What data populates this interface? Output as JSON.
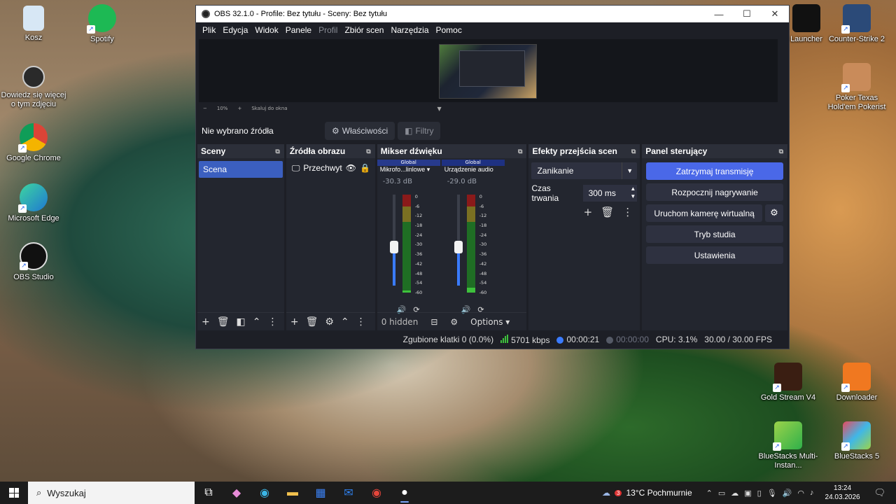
{
  "desktop": {
    "icons_left": [
      {
        "label": "Kosz"
      },
      {
        "label": "Dowiedz się więcej o tym zdjęciu"
      },
      {
        "label": "Google Chrome"
      },
      {
        "label": "Microsoft Edge"
      },
      {
        "label": "OBS Studio"
      }
    ],
    "icon_spotify": "Spotify",
    "icons_right": [
      {
        "label": "Launcher"
      },
      {
        "label": "Counter-Strike 2"
      },
      {
        "label": "Poker Texas Hold'em Pokerist"
      },
      {
        "label": "Gold Stream V4"
      },
      {
        "label": "Downloader"
      },
      {
        "label": "BlueStacks Multi-Instan..."
      },
      {
        "label": "BlueStacks 5"
      }
    ]
  },
  "obs": {
    "title": "OBS 32.1.0 - Profile: Bez tytułu - Sceny: Bez tytułu",
    "menu": [
      "Plik",
      "Edycja",
      "Widok",
      "Panele",
      "Profil",
      "Zbiór scen",
      "Narzędzia",
      "Pomoc"
    ],
    "zoom": {
      "minus": "−",
      "value": "10%",
      "plus": "+",
      "fit": "Skaluj do okna"
    },
    "no_source": "Nie wybrano źródła",
    "properties_btn": "Właściwości",
    "filters_btn": "Filtry",
    "docks": {
      "scenes": {
        "title": "Sceny",
        "items": [
          "Scena"
        ]
      },
      "sources": {
        "title": "Źródła obrazu",
        "items": [
          "Przechwyt"
        ]
      },
      "mixer": {
        "title": "Mikser dźwięku",
        "channels": [
          {
            "tag": "Global",
            "name": "Mikrofo...linlowe",
            "db": "-30.3 dB",
            "level": 0.42,
            "meter": 0.02
          },
          {
            "tag": "Global",
            "name": "Urządzenie audio",
            "db": "-29.0 dB",
            "level": 0.42,
            "meter": 0.05
          }
        ],
        "scale": [
          "0",
          "-6",
          "-12",
          "-18",
          "-24",
          "-30",
          "-36",
          "-42",
          "-48",
          "-54",
          "-60"
        ],
        "hidden": "0 hidden",
        "options": "Options"
      },
      "transitions": {
        "title": "Efekty przejścia scen",
        "selected": "Zanikanie",
        "duration_label": "Czas trwania",
        "duration_value": "300 ms"
      },
      "controls": {
        "title": "Panel sterujący",
        "stop_stream": "Zatrzymaj transmisję",
        "start_record": "Rozpocznij nagrywanie",
        "virtual_cam": "Uruchom kamerę wirtualną",
        "studio_mode": "Tryb studia",
        "settings": "Ustawienia"
      }
    },
    "status": {
      "dropped": "Zgubione klatki 0 (0.0%)",
      "bitrate": "5701 kbps",
      "live_time": "00:00:21",
      "rec_time": "00:00:00",
      "cpu": "CPU: 3.1%",
      "fps": "30.00 / 30.00 FPS"
    }
  },
  "taskbar": {
    "search": "Wyszukaj",
    "weather_badge": "3",
    "weather": "13°C  Pochmurnie",
    "time": "13:24",
    "date": "24.03.2026"
  }
}
